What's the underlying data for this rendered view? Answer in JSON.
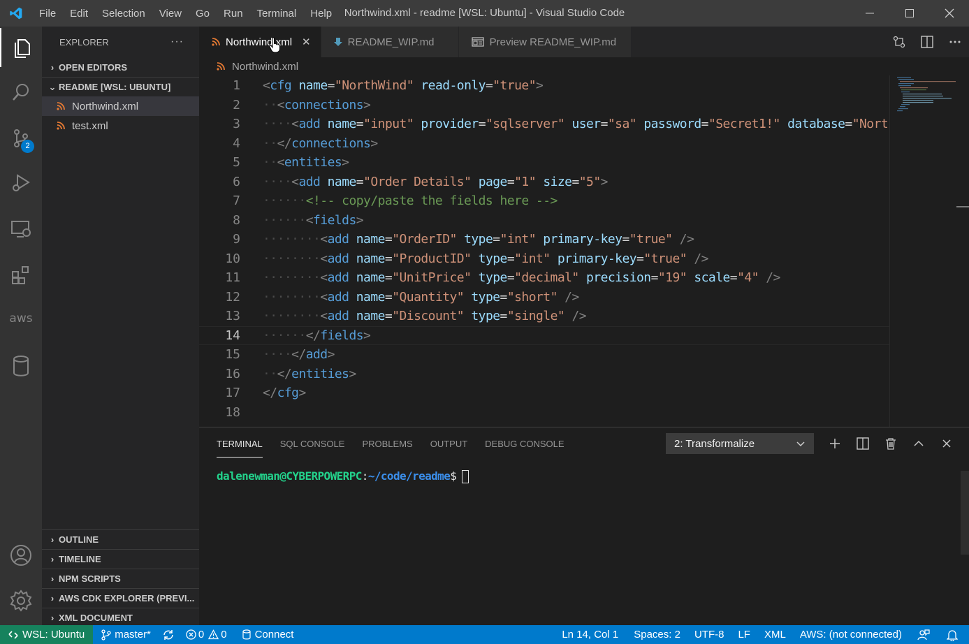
{
  "window": {
    "title": "Northwind.xml - readme [WSL: Ubuntu] - Visual Studio Code",
    "menu": [
      "File",
      "Edit",
      "Selection",
      "View",
      "Go",
      "Run",
      "Terminal",
      "Help"
    ]
  },
  "activity": {
    "scm_badge": "2",
    "aws_label": "aws"
  },
  "sidebar": {
    "title": "EXPLORER",
    "more": "···",
    "open_editors": "OPEN EDITORS",
    "folder": "README [WSL: UBUNTU]",
    "files": [
      "Northwind.xml",
      "test.xml"
    ],
    "bottom_sections": [
      "OUTLINE",
      "TIMELINE",
      "NPM SCRIPTS",
      "AWS CDK EXPLORER (PREVI...",
      "XML DOCUMENT"
    ]
  },
  "tabs": [
    {
      "label": "Northwind.xml",
      "close": "✕"
    },
    {
      "label": "README_WIP.md"
    },
    {
      "label": "Preview README_WIP.md"
    }
  ],
  "breadcrumb": "Northwind.xml",
  "editor": {
    "line_numbers": [
      "1",
      "2",
      "3",
      "4",
      "5",
      "6",
      "7",
      "8",
      "9",
      "10",
      "11",
      "12",
      "13",
      "14",
      "15",
      "16",
      "17",
      "18"
    ],
    "current_line": 14,
    "colors": {
      "tag": "#569cd6",
      "attr": "#9cdcfe",
      "value": "#ce9178",
      "comment": "#6a9955",
      "bracket": "#808080"
    }
  },
  "panel": {
    "tabs": [
      "TERMINAL",
      "SQL CONSOLE",
      "PROBLEMS",
      "OUTPUT",
      "DEBUG CONSOLE"
    ],
    "terminal_select": "2: Transformalize",
    "prompt": {
      "user": "dalenewman@CYBERPOWERPC",
      "colon": ":",
      "path": "~/code/readme",
      "sign": "$"
    }
  },
  "status": {
    "remote": "WSL: Ubuntu",
    "branch": "master*",
    "errors": "0",
    "warnings": "0",
    "connect": "Connect",
    "position": "Ln 14, Col 1",
    "spaces": "Spaces: 2",
    "encoding": "UTF-8",
    "eol": "LF",
    "language": "XML",
    "aws": "AWS: (not connected)"
  }
}
